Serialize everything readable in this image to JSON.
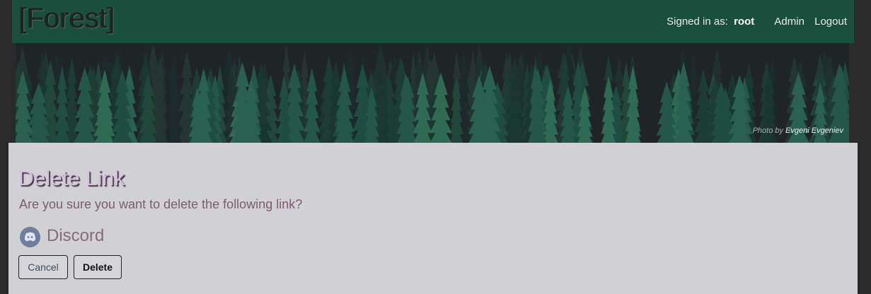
{
  "header": {
    "brand": "[Forest]",
    "signed_in_label": "Signed in as:",
    "username": "root",
    "nav": [
      "Admin",
      "Logout"
    ]
  },
  "banner": {
    "credit_prefix": "Photo by",
    "credit_name": "Evgeni Evgeniev"
  },
  "main": {
    "title": "Delete Link",
    "question": "Are you sure you want to delete the following link?",
    "link": {
      "name": "Discord",
      "icon": "discord-icon"
    },
    "buttons": {
      "cancel": "Cancel",
      "delete": "Delete"
    }
  },
  "colors": {
    "topbar": "#1a4f3e",
    "content_bg": "#d1d0d5",
    "title": "#d5c3e0",
    "text": "#7a5d6e"
  }
}
